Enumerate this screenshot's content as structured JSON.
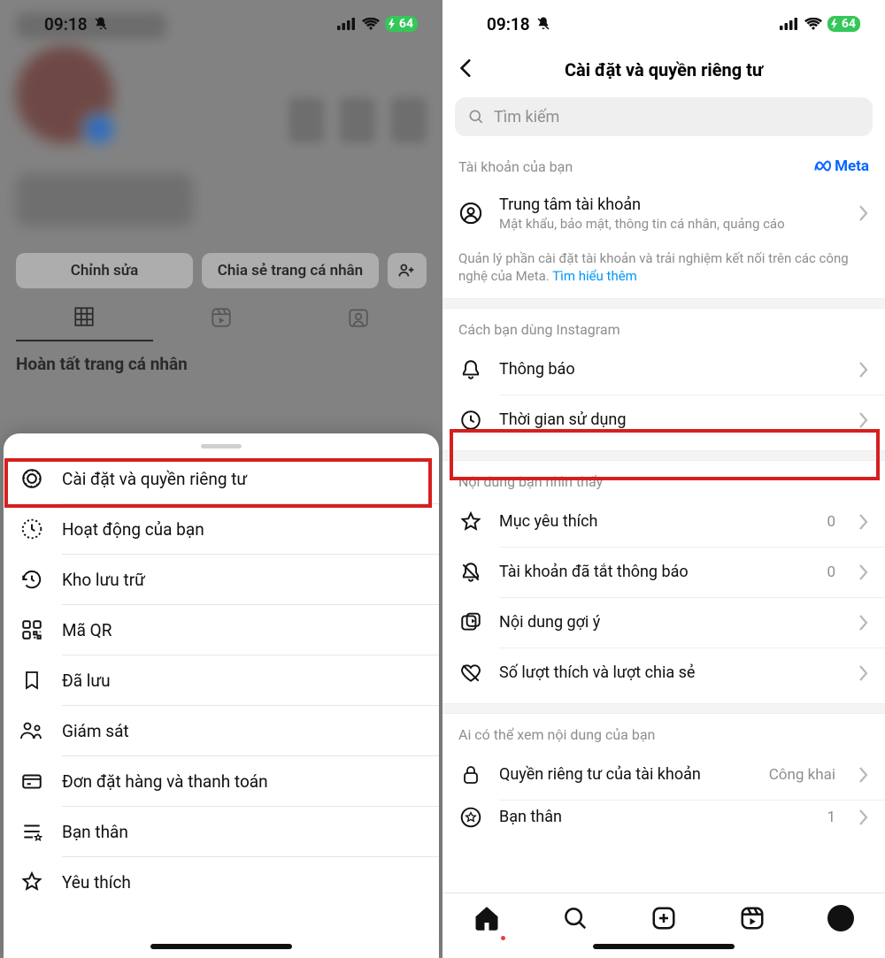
{
  "status": {
    "time": "09:18",
    "battery": "64"
  },
  "left": {
    "buttons": {
      "edit": "Chỉnh sửa",
      "share": "Chia sẻ trang cá nhân"
    },
    "section_title": "Hoàn tất trang cá nhân",
    "sheet": {
      "items": [
        {
          "label": "Cài đặt và quyền riêng tư"
        },
        {
          "label": "Hoạt động của bạn"
        },
        {
          "label": "Kho lưu trữ"
        },
        {
          "label": "Mã QR"
        },
        {
          "label": "Đã lưu"
        },
        {
          "label": "Giám sát"
        },
        {
          "label": "Đơn đặt hàng và thanh toán"
        },
        {
          "label": "Bạn thân"
        },
        {
          "label": "Yêu thích"
        }
      ]
    }
  },
  "right": {
    "title": "Cài đặt và quyền riêng tư",
    "search_placeholder": "Tìm kiếm",
    "account_section": {
      "label": "Tài khoản của bạn",
      "meta": "Meta",
      "row_title": "Trung tâm tài khoản",
      "row_sub": "Mật khẩu, bảo mật, thông tin cá nhân, quảng cáo",
      "note_a": "Quản lý phần cài đặt tài khoản và trải nghiệm kết nối trên các công nghệ của Meta. ",
      "note_link": "Tìm hiểu thêm"
    },
    "usage_section": {
      "label": "Cách bạn dùng Instagram",
      "rows": [
        {
          "label": "Thông báo"
        },
        {
          "label": "Thời gian sử dụng"
        }
      ]
    },
    "content_section": {
      "label": "Nội dung bạn nhìn thấy",
      "rows": [
        {
          "label": "Mục yêu thích",
          "value": "0"
        },
        {
          "label": "Tài khoản đã tắt thông báo",
          "value": "0"
        },
        {
          "label": "Nội dung gợi ý"
        },
        {
          "label": "Số lượt thích và lượt chia sẻ"
        }
      ]
    },
    "visibility_section": {
      "label": "Ai có thể xem nội dung của bạn",
      "rows": [
        {
          "label": "Quyền riêng tư của tài khoản",
          "value": "Công khai"
        },
        {
          "label": "Bạn thân",
          "value": "1"
        }
      ]
    }
  }
}
